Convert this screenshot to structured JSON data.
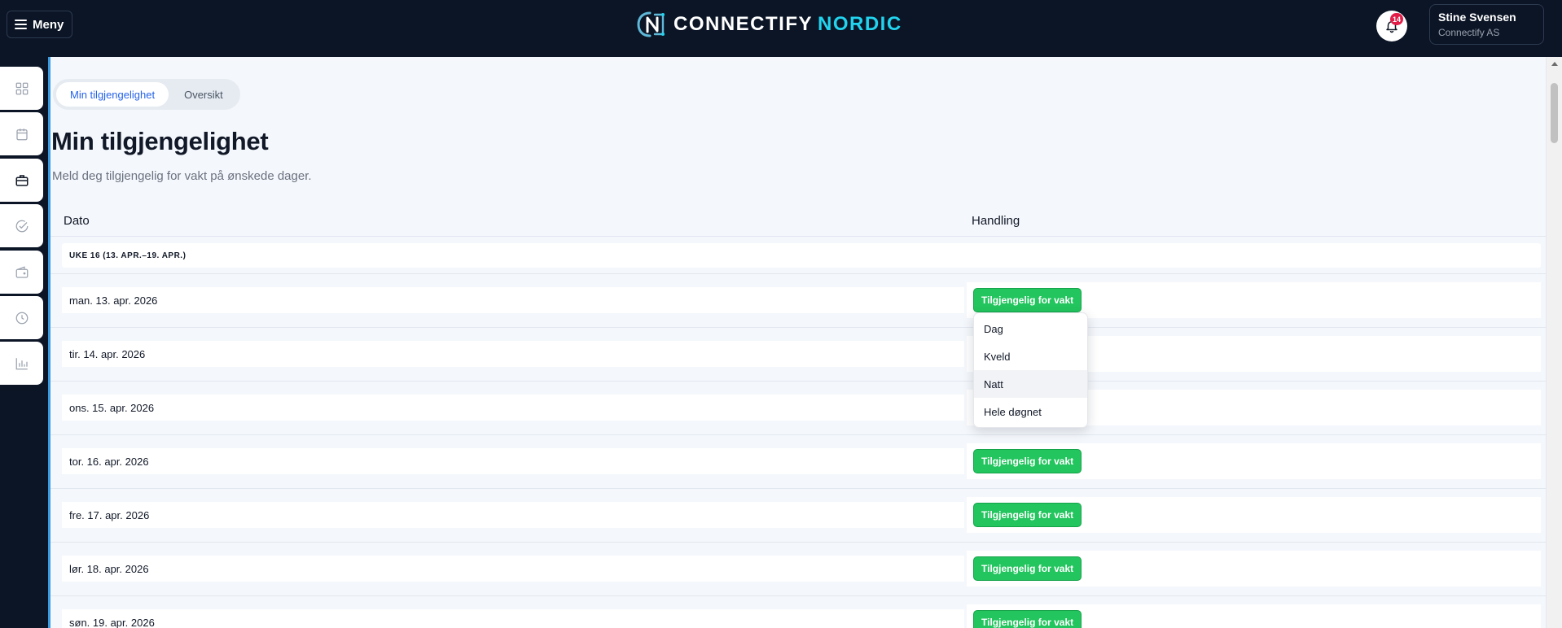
{
  "header": {
    "menu_label": "Meny",
    "brand": {
      "name_main": "CONNECTIFY",
      "name_accent": "NORDIC",
      "accent_color": "#22d3ee"
    },
    "notifications": {
      "count": "14",
      "icon": "bell-icon"
    },
    "user": {
      "name": "Stine Svensen",
      "company": "Connectify AS"
    }
  },
  "sidebar": {
    "items": [
      {
        "icon": "grid-icon"
      },
      {
        "icon": "calendar-icon"
      },
      {
        "icon": "briefcase-icon",
        "active": true
      },
      {
        "icon": "check-circle-icon"
      },
      {
        "icon": "wallet-icon"
      },
      {
        "icon": "clock-icon"
      },
      {
        "icon": "bar-chart-icon"
      }
    ]
  },
  "main": {
    "tabs": [
      {
        "label": "Min tilgjengelighet",
        "active": true
      },
      {
        "label": "Oversikt",
        "active": false
      }
    ],
    "title": "Min tilgjengelighet",
    "subtitle": "Meld deg tilgjengelig for vakt på ønskede dager.",
    "table": {
      "columns": [
        "Dato",
        "Handling"
      ],
      "week_label": "UKE 16 (13. APR.–19. APR.)",
      "button_label": "Tilgjengelig for vakt",
      "rows": [
        {
          "date": "man. 13. apr. 2026",
          "show_button": true
        },
        {
          "date": "tir. 14. apr. 2026",
          "show_button": false
        },
        {
          "date": "ons. 15. apr. 2026",
          "show_button": false
        },
        {
          "date": "tor. 16. apr. 2026",
          "show_button": true
        },
        {
          "date": "fre. 17. apr. 2026",
          "show_button": true
        },
        {
          "date": "lør. 18. apr. 2026",
          "show_button": true
        },
        {
          "date": "søn. 19. apr. 2026",
          "show_button": true
        }
      ]
    },
    "dropdown": {
      "options": [
        "Dag",
        "Kveld",
        "Natt",
        "Hele døgnet"
      ],
      "highlighted": "Natt"
    }
  },
  "colors": {
    "topbar": "#0b1526",
    "accent_blue": "#2563eb",
    "success_green": "#22c55e"
  }
}
